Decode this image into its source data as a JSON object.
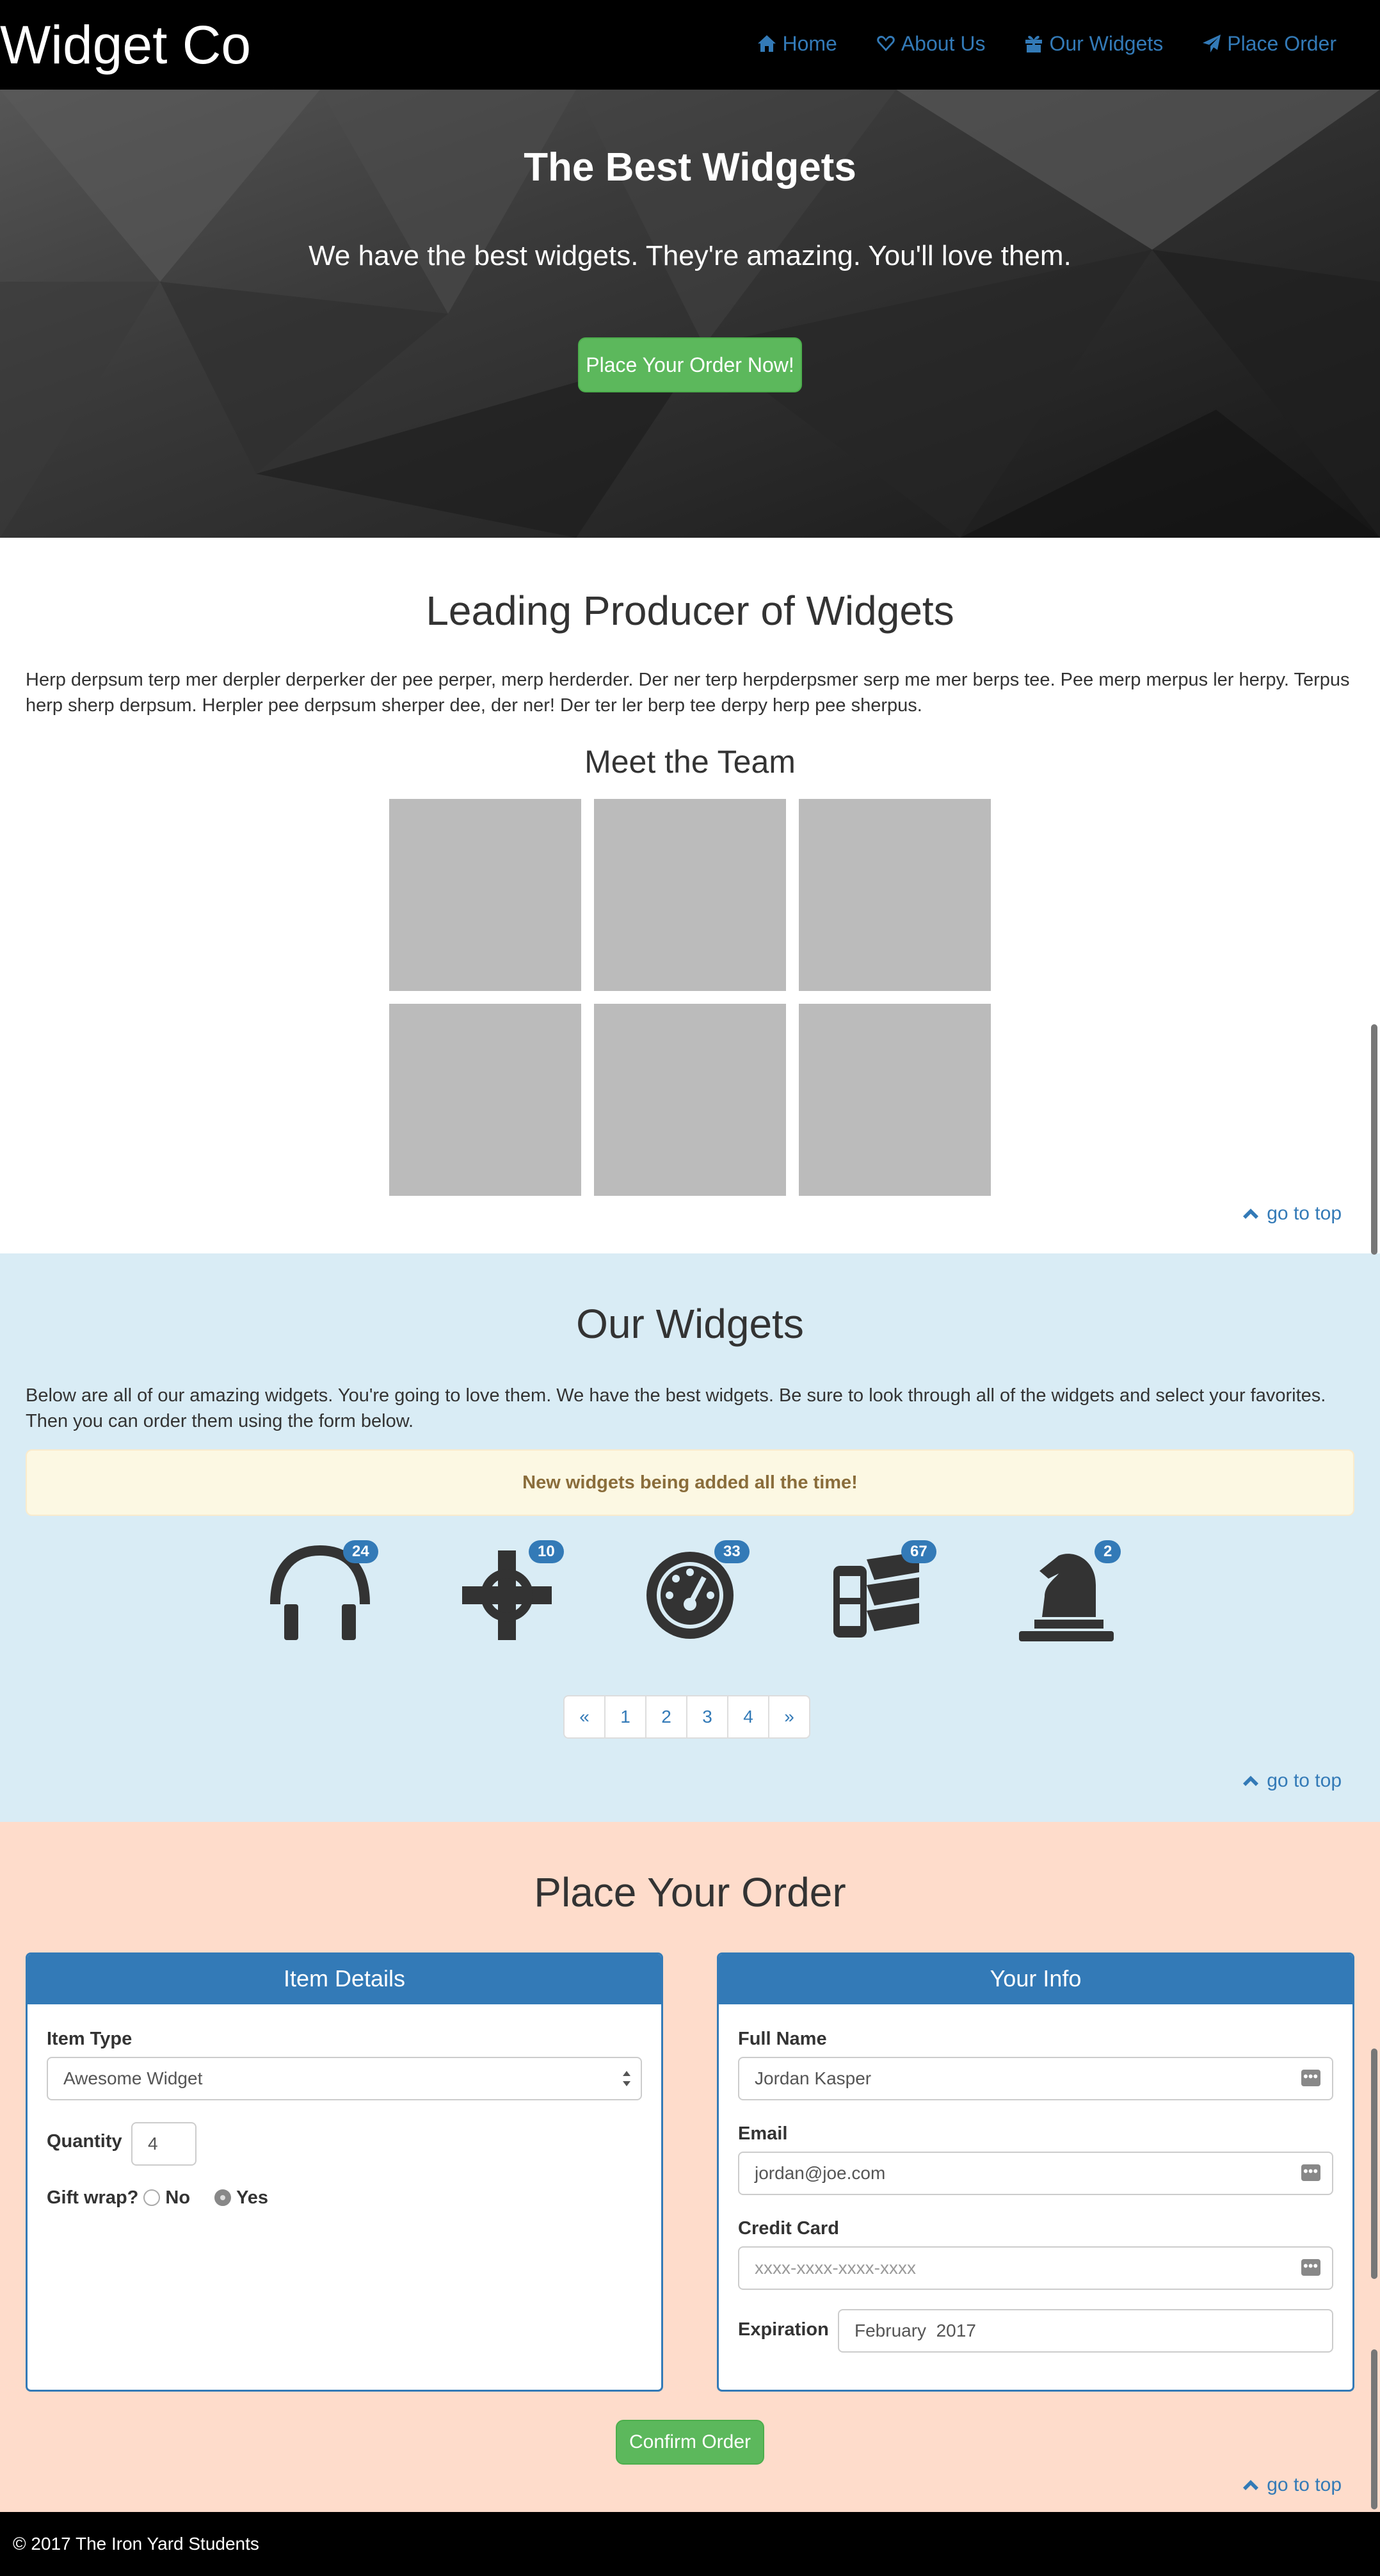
{
  "navbar": {
    "brand": "Widget Co",
    "items": [
      {
        "label": "Home",
        "icon": "home-icon"
      },
      {
        "label": "About Us",
        "icon": "heart-icon"
      },
      {
        "label": "Our Widgets",
        "icon": "gift-icon"
      },
      {
        "label": "Place Order",
        "icon": "send-icon"
      }
    ]
  },
  "hero": {
    "title": "The Best Widgets",
    "subtitle": "We have the best widgets. They're amazing. You'll love them.",
    "button": "Place Your Order Now!"
  },
  "about": {
    "title": "Leading Producer of Widgets",
    "body": "Herp derpsum terp mer derpler derperker der pee perper, merp herderder. Der ner terp herpderpsmer serp me mer berps tee. Pee merp merpus ler herpy. Terpus herp sherp derpsum. Herpler pee derpsum sherper dee, der ner! Der ter ler berp tee derpy herp pee sherpus.",
    "team_title": "Meet the Team",
    "go_to_top": "go to top"
  },
  "widgets": {
    "title": "Our Widgets",
    "body": "Below are all of our amazing widgets. You're going to love them. We have the best widgets. Be sure to look through all of the widgets and select your favorites. Then you can order them using the form below.",
    "alert": "New widgets being added all the time!",
    "items": [
      {
        "icon": "headphones-icon",
        "count": "24"
      },
      {
        "icon": "crosshair-icon",
        "count": "10"
      },
      {
        "icon": "dashboard-icon",
        "count": "33"
      },
      {
        "icon": "film-icon",
        "count": "67"
      },
      {
        "icon": "chess-knight-icon",
        "count": "2"
      }
    ],
    "pagination": [
      "«",
      "1",
      "2",
      "3",
      "4",
      "»"
    ],
    "go_to_top": "go to top"
  },
  "order": {
    "title": "Place Your Order",
    "item_details": {
      "heading": "Item Details",
      "item_type_label": "Item Type",
      "item_type_value": "Awesome Widget",
      "quantity_label": "Quantity",
      "quantity_value": "4",
      "gift_wrap_label": "Gift wrap?",
      "no_label": "No",
      "yes_label": "Yes"
    },
    "your_info": {
      "heading": "Your Info",
      "full_name_label": "Full Name",
      "full_name_value": "Jordan Kasper",
      "email_label": "Email",
      "email_value": "jordan@joe.com",
      "credit_card_label": "Credit Card",
      "credit_card_placeholder": "xxxx-xxxx-xxxx-xxxx",
      "expiration_label": "Expiration",
      "expiration_value": "February  2017"
    },
    "confirm": "Confirm Order",
    "go_to_top": "go to top"
  },
  "footer": {
    "text": "© 2017 The Iron Yard Students"
  },
  "colors": {
    "primary": "#337ab7",
    "success": "#5cb85c",
    "widgets_bg": "#d9ecf5",
    "order_bg": "#fedccb"
  }
}
